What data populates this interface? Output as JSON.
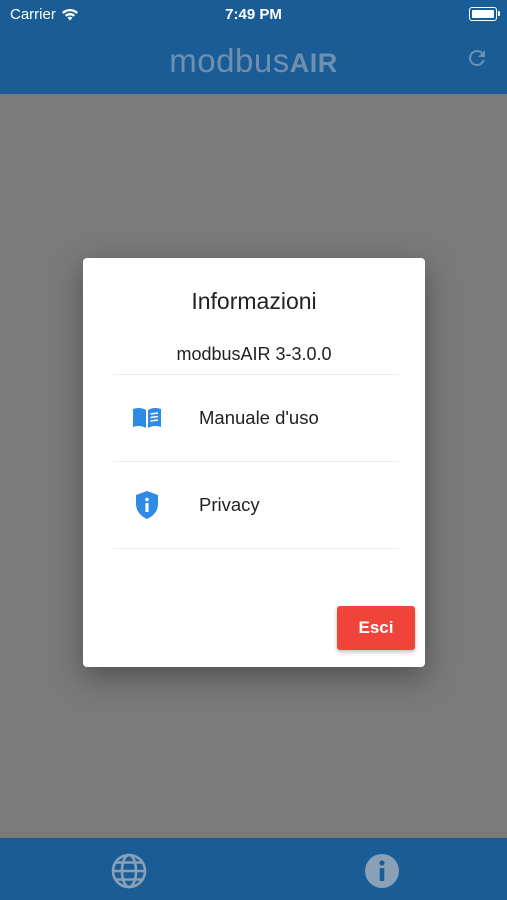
{
  "status_bar": {
    "carrier": "Carrier",
    "time": "7:49 PM"
  },
  "header": {
    "title_light": "modbus",
    "title_bold": "AIR",
    "refresh_icon": "refresh-icon"
  },
  "dialog": {
    "title": "Informazioni",
    "version": "modbusAIR 3-3.0.0",
    "items": [
      {
        "label": "Manuale d'uso",
        "icon": "book-icon"
      },
      {
        "label": "Privacy",
        "icon": "shield-info-icon"
      }
    ],
    "close_label": "Esci"
  },
  "bottom_bar": {
    "icons": [
      "globe-icon",
      "info-icon"
    ]
  },
  "colors": {
    "header_bg": "#1a5d96",
    "overlay_bg": "#7a7a7a",
    "accent_blue": "#2f8ae6",
    "button_red": "#f0443a"
  }
}
